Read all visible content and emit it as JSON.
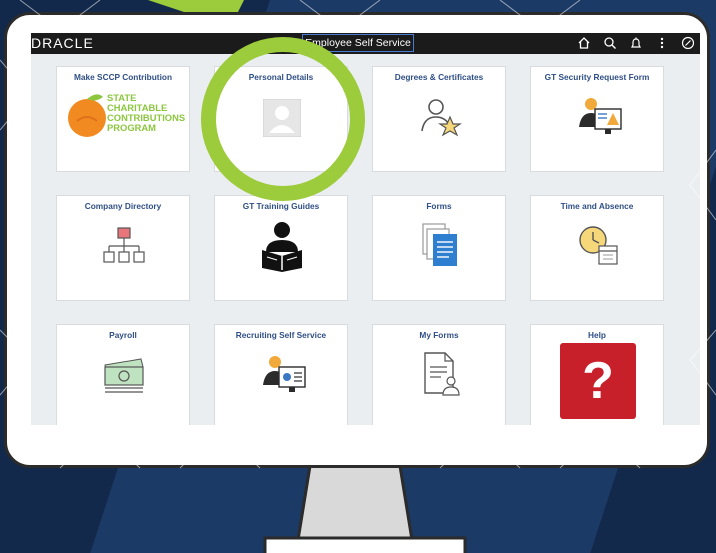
{
  "app": {
    "brand": "DRACLE",
    "title": "Employee Self Service"
  },
  "topbar_icons": [
    "home-icon",
    "search-icon",
    "notification-bell-icon",
    "more-actions-icon",
    "compass-icon"
  ],
  "tiles": [
    {
      "title": "Make SCCP Contribution",
      "icon": "sccp-logo"
    },
    {
      "title": "Personal Details",
      "icon": "person-silhouette-icon"
    },
    {
      "title": "Degrees & Certificates",
      "icon": "person-star-icon"
    },
    {
      "title": "GT Security Request Form",
      "icon": "security-request-icon"
    },
    {
      "title": "Company Directory",
      "icon": "org-chart-icon"
    },
    {
      "title": "GT Training Guides",
      "icon": "reading-person-icon"
    },
    {
      "title": "Forms",
      "icon": "documents-icon"
    },
    {
      "title": "Time and Absence",
      "icon": "clock-calendar-icon"
    },
    {
      "title": "Payroll",
      "icon": "money-icon"
    },
    {
      "title": "Recruiting Self Service",
      "icon": "recruiting-icon"
    },
    {
      "title": "My Forms",
      "icon": "person-document-icon"
    },
    {
      "title": "Help",
      "icon": "question-mark-icon"
    }
  ],
  "sccp_logo": {
    "line1": "STATE",
    "line2": "CHARITABLE",
    "line3": "CONTRIBUTIONS",
    "line4": "PROGRAM"
  },
  "help_glyph": "?",
  "colors": {
    "background": "#13294b",
    "highlight": "#9ccb3b",
    "tile_title": "#2f4f86",
    "help_red": "#c8202b"
  }
}
